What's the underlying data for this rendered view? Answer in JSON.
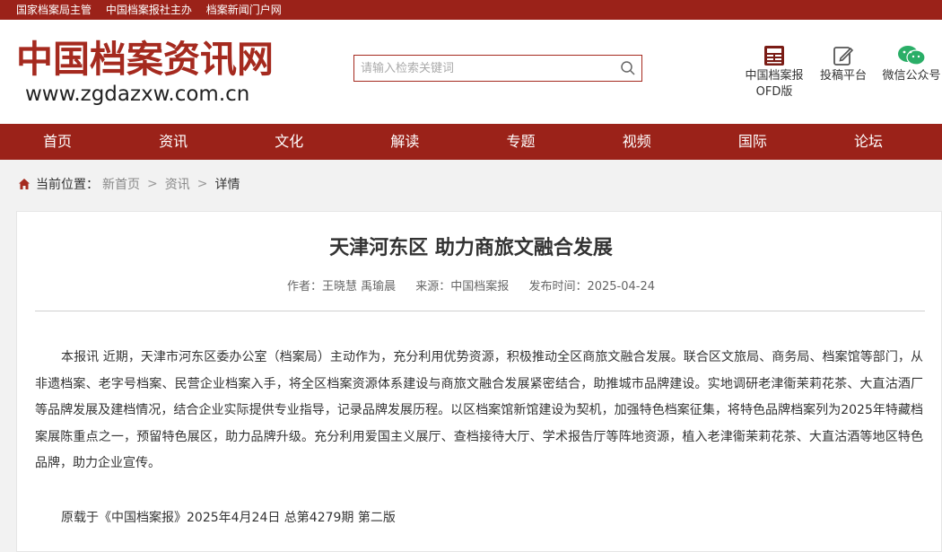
{
  "topbar": {
    "item1": "国家档案局主管",
    "item2": "中国档案报社主办",
    "item3": "档案新闻门户网"
  },
  "logo": {
    "name": "中国档案资讯网",
    "url": "www.zgdazxw.com.cn"
  },
  "search": {
    "placeholder": "请输入检索关键词"
  },
  "quick_links": {
    "newspaper_line1": "中国档案报",
    "newspaper_line2": "OFD版",
    "submit": "投稿平台",
    "wechat": "微信公众号"
  },
  "nav": {
    "home": "首页",
    "news": "资讯",
    "culture": "文化",
    "interpret": "解读",
    "topics": "专题",
    "video": "视频",
    "international": "国际",
    "forum": "论坛"
  },
  "breadcrumb": {
    "label": "当前位置：",
    "home": "新首页",
    "sep": ">",
    "news": "资讯",
    "current": "详情"
  },
  "article": {
    "title": "天津河东区 助力商旅文融合发展",
    "author": "作者：王晓慧 禹瑜晨",
    "source": "来源：中国档案报",
    "date": "发布时间：2025-04-24",
    "body": "本报讯 近期，天津市河东区委办公室（档案局）主动作为，充分利用优势资源，积极推动全区商旅文融合发展。联合区文旅局、商务局、档案馆等部门，从非遗档案、老字号档案、民营企业档案入手，将全区档案资源体系建设与商旅文融合发展紧密结合，助推城市品牌建设。实地调研老津衞茉莉花茶、大直沽酒厂等品牌发展及建档情况，结合企业实际提供专业指导，记录品牌发展历程。以区档案馆新馆建设为契机，加强特色档案征集，将特色品牌档案列为2025年特藏档案展陈重点之一，预留特色展区，助力品牌升级。充分利用爱国主义展厅、查档接待大厅、学术报告厅等阵地资源，植入老津衞茉莉花茶、大直沽酒等地区特色品牌，助力企业宣传。",
    "reprint": "原载于《中国档案报》2025年4月24日 总第4279期 第二版"
  },
  "colors": {
    "brand_red": "#9b2219",
    "logo_red": "#a52a1f",
    "wechat_green": "#2aae67"
  }
}
